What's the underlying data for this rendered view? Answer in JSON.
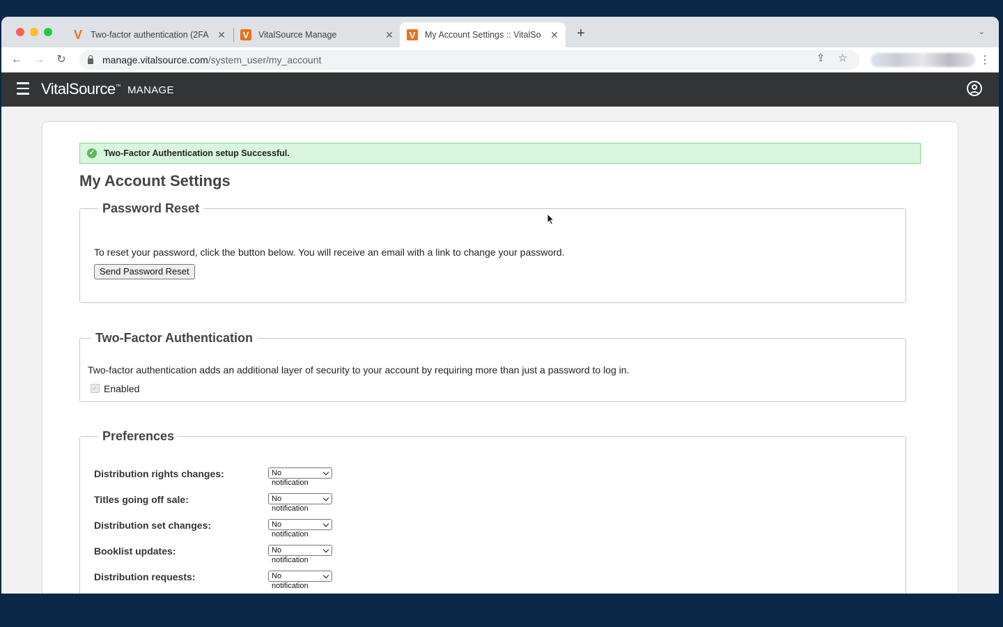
{
  "browser": {
    "tabs": [
      {
        "title": "Two-factor authentication (2FA",
        "favicon": "V"
      },
      {
        "title": "VitalSource Manage",
        "favicon": "V"
      },
      {
        "title": "My Account Settings :: VitalSo",
        "favicon": "V"
      }
    ],
    "url_host": "manage.vitalsource.com",
    "url_path": "/system_user/my_account"
  },
  "app": {
    "brand": "VitalSource",
    "brand_mark": "™",
    "brand_sub": "MANAGE"
  },
  "alert": {
    "message": "Two-Factor Authentication setup Successful."
  },
  "page": {
    "title": "My Account Settings"
  },
  "password_reset": {
    "legend": "Password Reset",
    "description": "To reset your password, click the button below. You will receive an email with a link to change your password.",
    "button": "Send Password Reset"
  },
  "two_factor": {
    "legend": "Two-Factor Authentication",
    "description": "Two-factor authentication adds an additional layer of security to your account by requiring more than just a password to log in.",
    "checkbox_label": "Enabled",
    "enabled": true
  },
  "preferences": {
    "legend": "Preferences",
    "items": [
      {
        "label": "Distribution rights changes:",
        "value": "No notification"
      },
      {
        "label": "Titles going off sale:",
        "value": "No notification"
      },
      {
        "label": "Distribution set changes:",
        "value": "No notification"
      },
      {
        "label": "Booklist updates:",
        "value": "No notification"
      },
      {
        "label": "Distribution requests:",
        "value": "No notification"
      }
    ]
  },
  "colors": {
    "brand_orange": "#e8731c",
    "appbar": "#333436",
    "success_bg": "#d8f5dd",
    "success_border": "#84d88f"
  }
}
